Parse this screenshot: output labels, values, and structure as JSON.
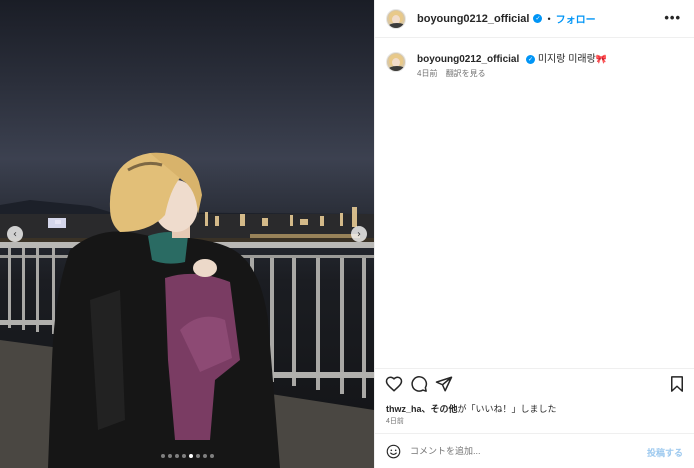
{
  "post": {
    "username": "boyoung0212_official",
    "verified_mark": "✓",
    "separator": "•",
    "follow_label": "フォロー",
    "more_label": "•••",
    "caption_text": "미지랑 미래랑",
    "caption_emoji": "🎀",
    "caption_time": "4日前",
    "see_translation": "翻訳を見る",
    "liked_by_user": "thwz_ha",
    "liked_by_rest": "、その他",
    "liked_by_suffix": "が「いいね！」しました",
    "post_date": "4日前",
    "comment_placeholder": "コメントを追加...",
    "post_button": "投稿する"
  },
  "carousel": {
    "prev_label": "‹",
    "next_label": "›",
    "slide_count": 8,
    "active_slide": 4
  },
  "icons": {
    "like": "heart-icon",
    "comment": "comment-icon",
    "share": "share-icon",
    "save": "bookmark-icon",
    "emoji": "emoji-icon",
    "more": "more-icon"
  },
  "colors": {
    "accent": "#0095f6",
    "post_button_disabled": "#9dc9ef",
    "muted_text": "#737373"
  }
}
